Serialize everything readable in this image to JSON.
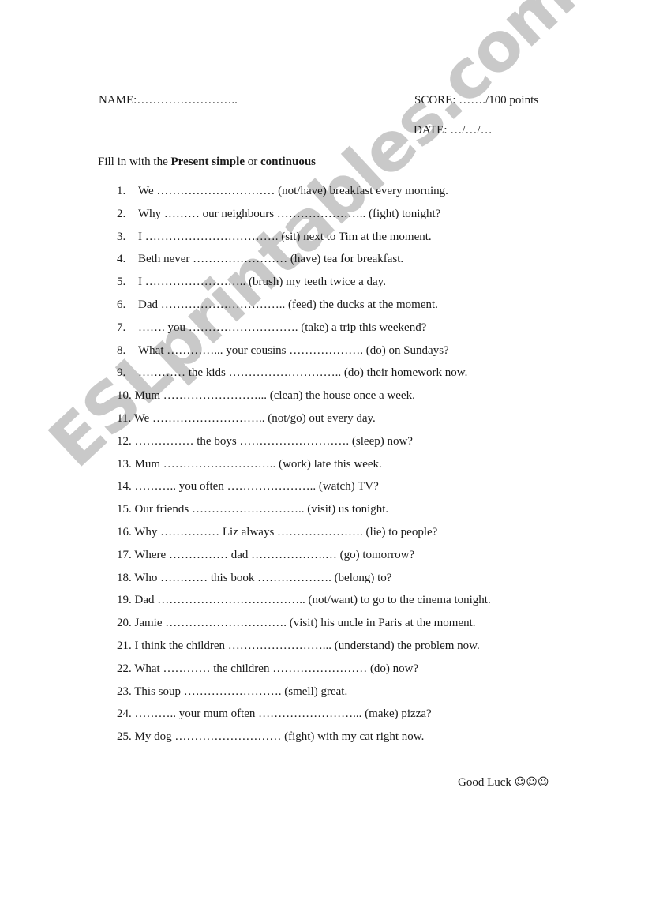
{
  "watermark": "ESLprintables.com",
  "header": {
    "name_label": "NAME:……………………..",
    "score_label": "SCORE: ……./100 points",
    "date_label": "DATE: …/…/…"
  },
  "instructions": {
    "prefix": "Fill in with the ",
    "bold1": "Present simple",
    "middle": " or ",
    "bold2": "continuous"
  },
  "exercises": [
    {
      "num": "1.",
      "text": "We ………………………… (not/have) breakfast every morning."
    },
    {
      "num": "2.",
      "text": "Why ……… our neighbours ………………….. (fight) tonight?"
    },
    {
      "num": "3.",
      "text": "I ……………………………. (sit) next to Tim at the moment."
    },
    {
      "num": "4.",
      "text": "Beth never  …………………… (have) tea for breakfast."
    },
    {
      "num": "5.",
      "text": "I …………………….. (brush) my teeth twice a day."
    },
    {
      "num": "6.",
      "text": "Dad ………………………….. (feed) the ducks at the moment."
    },
    {
      "num": "7.",
      "text": "……. you ………………………. (take) a trip this weekend?"
    },
    {
      "num": "8.",
      "text": "What …………... your cousins ………………. (do) on Sundays?"
    },
    {
      "num": "9.",
      "text": "………… the kids ……………………….. (do) their homework now."
    },
    {
      "num": "10.",
      "text": "Mum ……………………... (clean) the house once a week."
    },
    {
      "num": "11.",
      "text": "We ……………………….. (not/go) out every day."
    },
    {
      "num": "12.",
      "text": "…………… the boys ………………………. (sleep) now?"
    },
    {
      "num": "13.",
      "text": "Mum ……………………….. (work) late this week."
    },
    {
      "num": "14.",
      "text": "……….. you often ………………….. (watch) TV?"
    },
    {
      "num": "15.",
      "text": "Our friends ……………………….. (visit) us tonight."
    },
    {
      "num": "16.",
      "text": "Why …………… Liz always …………………. (lie) to people?"
    },
    {
      "num": "17.",
      "text": "Where …………… dad ……………….… (go) tomorrow?"
    },
    {
      "num": "18.",
      "text": "Who ………… this book ………………. (belong) to?"
    },
    {
      "num": "19.",
      "text": "Dad ……………………………….. (not/want) to go to the cinema tonight."
    },
    {
      "num": "20.",
      "text": "Jamie …………………………. (visit) his uncle in Paris at the moment."
    },
    {
      "num": "21.",
      "text": "I think the children ……………………... (understand) the problem now."
    },
    {
      "num": "22.",
      "text": "What ………… the children …………………… (do) now?"
    },
    {
      "num": "23.",
      "text": "This soup ……………………. (smell) great."
    },
    {
      "num": "24.",
      "text": "……….. your mum often ……………………... (make) pizza?"
    },
    {
      "num": "25.",
      "text": "My dog ……………………… (fight) with my cat right now."
    }
  ],
  "footer": {
    "good_luck": "Good Luck ",
    "smileys": "☺☺☺"
  }
}
